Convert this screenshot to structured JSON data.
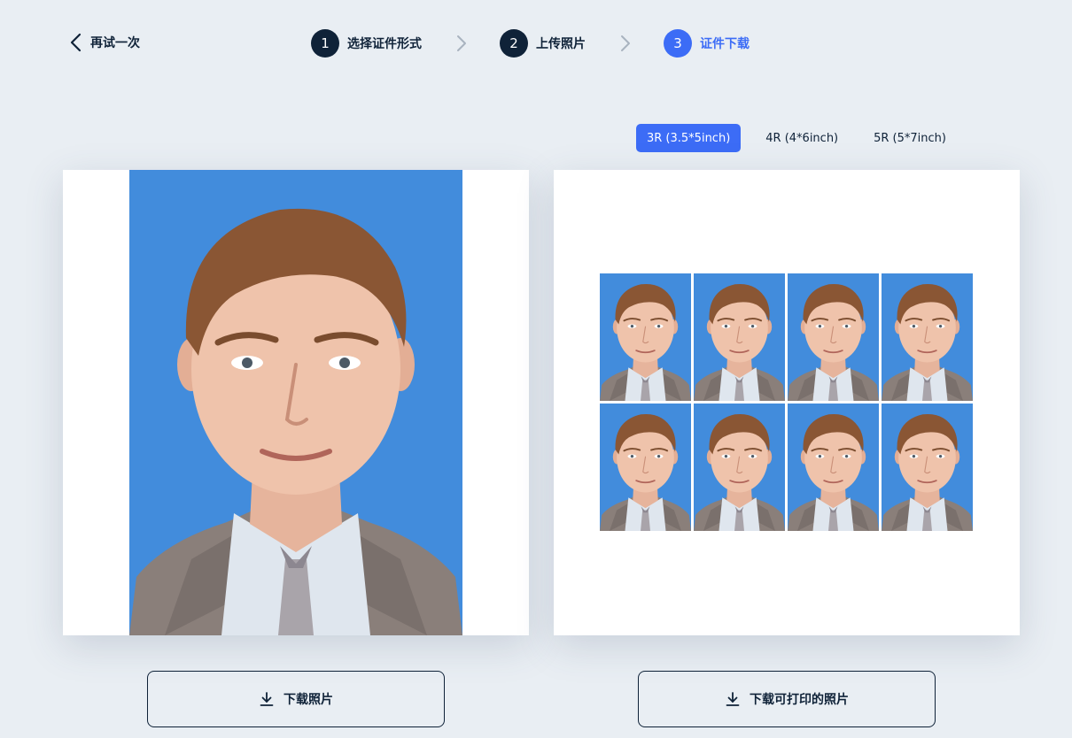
{
  "back": {
    "label": "再试一次"
  },
  "steps": [
    {
      "num": "1",
      "label": "选择证件形式"
    },
    {
      "num": "2",
      "label": "上传照片"
    },
    {
      "num": "3",
      "label": "证件下载"
    }
  ],
  "print_sizes": [
    "3R (3.5*5inch)",
    "4R (4*6inch)",
    "5R (5*7inch)"
  ],
  "selected_size": "3R (3.5*5inch)",
  "buttons": {
    "download_photo": "下载照片",
    "download_printable": "下载可打印的照片"
  },
  "colors": {
    "accent": "#3c6cf6",
    "dark": "#0f2238",
    "background": "#e9eef3",
    "photo_background": "#428cdc"
  }
}
